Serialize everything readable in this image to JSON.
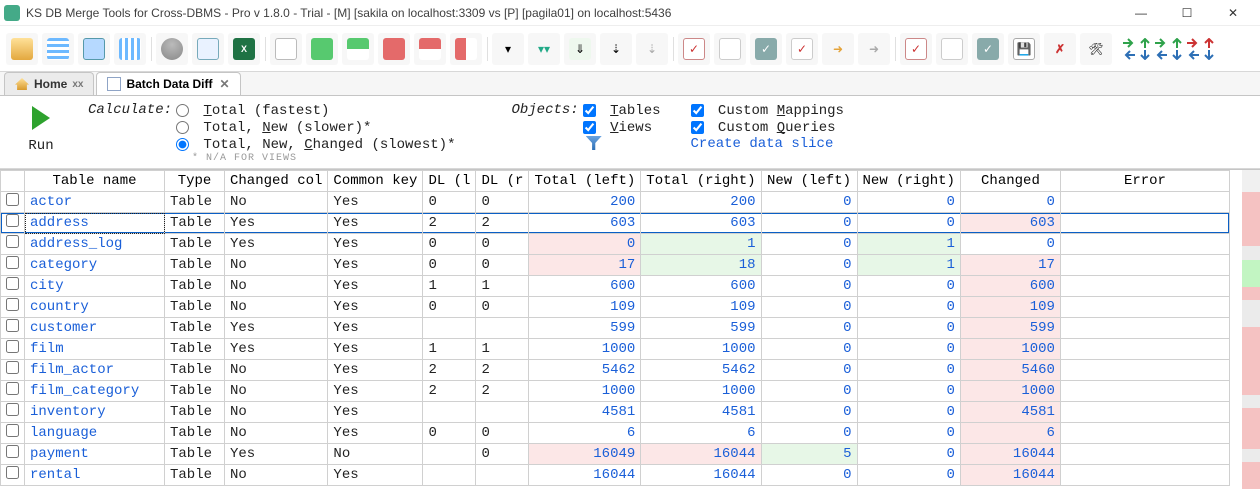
{
  "titlebar": {
    "text": "KS DB Merge Tools for Cross-DBMS - Pro v 1.8.0 - Trial - [M] [sakila on localhost:3309 vs [P] [pagila01] on localhost:5436"
  },
  "tabs": {
    "home": "Home",
    "active": "Batch Data Diff",
    "home_xx": "xx"
  },
  "options": {
    "run": "Run",
    "calculate_label": "Calculate:",
    "calc_total": "Total (fastest)",
    "calc_total_new": "Total, New (slower)*",
    "calc_total_new_chg": "Total, New, Changed (slowest)*",
    "na_note": "* N/A FOR VIEWS",
    "objects_label": "Objects:",
    "tables": "Tables",
    "views": "Views",
    "custom_mappings": "Custom Mappings",
    "custom_queries": "Custom Queries",
    "create_slice": "Create data slice"
  },
  "columns": {
    "name": "Table name",
    "type": "Type",
    "chgcol": "Changed col",
    "ckey": "Common key",
    "dll": "DL (l",
    "dlr": "DL (r",
    "tl": "Total (left)",
    "tr": "Total (right)",
    "nl": "New (left)",
    "nr": "New (right)",
    "chg": "Changed",
    "err": "Error"
  },
  "rows": [
    {
      "name": "actor",
      "type": "Table",
      "chgcol": "No",
      "ckey": "Yes",
      "dll": "0",
      "dlr": "0",
      "tl": "200",
      "tr": "200",
      "nl": "0",
      "nr": "0",
      "chg": "0",
      "err": "",
      "sel": false,
      "hl": {}
    },
    {
      "name": "address",
      "type": "Table",
      "chgcol": "Yes",
      "ckey": "Yes",
      "dll": "2",
      "dlr": "2",
      "tl": "603",
      "tr": "603",
      "nl": "0",
      "nr": "0",
      "chg": "603",
      "err": "",
      "sel": true,
      "hl": {
        "chg": "r"
      }
    },
    {
      "name": "address_log",
      "type": "Table",
      "chgcol": "Yes",
      "ckey": "Yes",
      "dll": "0",
      "dlr": "0",
      "tl": "0",
      "tr": "1",
      "nl": "0",
      "nr": "1",
      "chg": "0",
      "err": "",
      "sel": false,
      "hl": {
        "tl": "r",
        "tr": "g",
        "nr": "g"
      }
    },
    {
      "name": "category",
      "type": "Table",
      "chgcol": "No",
      "ckey": "Yes",
      "dll": "0",
      "dlr": "0",
      "tl": "17",
      "tr": "18",
      "nl": "0",
      "nr": "1",
      "chg": "17",
      "err": "",
      "sel": false,
      "hl": {
        "tl": "r",
        "tr": "g",
        "nr": "g",
        "chg": "r"
      }
    },
    {
      "name": "city",
      "type": "Table",
      "chgcol": "No",
      "ckey": "Yes",
      "dll": "1",
      "dlr": "1",
      "tl": "600",
      "tr": "600",
      "nl": "0",
      "nr": "0",
      "chg": "600",
      "err": "",
      "sel": false,
      "hl": {
        "chg": "r"
      }
    },
    {
      "name": "country",
      "type": "Table",
      "chgcol": "No",
      "ckey": "Yes",
      "dll": "0",
      "dlr": "0",
      "tl": "109",
      "tr": "109",
      "nl": "0",
      "nr": "0",
      "chg": "109",
      "err": "",
      "sel": false,
      "hl": {
        "chg": "r"
      }
    },
    {
      "name": "customer",
      "type": "Table",
      "chgcol": "Yes",
      "ckey": "Yes",
      "dll": "",
      "dlr": "",
      "tl": "599",
      "tr": "599",
      "nl": "0",
      "nr": "0",
      "chg": "599",
      "err": "",
      "sel": false,
      "hl": {
        "chg": "r"
      }
    },
    {
      "name": "film",
      "type": "Table",
      "chgcol": "Yes",
      "ckey": "Yes",
      "dll": "1",
      "dlr": "1",
      "tl": "1000",
      "tr": "1000",
      "nl": "0",
      "nr": "0",
      "chg": "1000",
      "err": "",
      "sel": false,
      "hl": {
        "chg": "r"
      }
    },
    {
      "name": "film_actor",
      "type": "Table",
      "chgcol": "No",
      "ckey": "Yes",
      "dll": "2",
      "dlr": "2",
      "tl": "5462",
      "tr": "5462",
      "nl": "0",
      "nr": "0",
      "chg": "5460",
      "err": "",
      "sel": false,
      "hl": {
        "chg": "r"
      }
    },
    {
      "name": "film_category",
      "type": "Table",
      "chgcol": "No",
      "ckey": "Yes",
      "dll": "2",
      "dlr": "2",
      "tl": "1000",
      "tr": "1000",
      "nl": "0",
      "nr": "0",
      "chg": "1000",
      "err": "",
      "sel": false,
      "hl": {
        "chg": "r"
      }
    },
    {
      "name": "inventory",
      "type": "Table",
      "chgcol": "No",
      "ckey": "Yes",
      "dll": "",
      "dlr": "",
      "tl": "4581",
      "tr": "4581",
      "nl": "0",
      "nr": "0",
      "chg": "4581",
      "err": "",
      "sel": false,
      "hl": {
        "chg": "r"
      }
    },
    {
      "name": "language",
      "type": "Table",
      "chgcol": "No",
      "ckey": "Yes",
      "dll": "0",
      "dlr": "0",
      "tl": "6",
      "tr": "6",
      "nl": "0",
      "nr": "0",
      "chg": "6",
      "err": "",
      "sel": false,
      "hl": {
        "chg": "r"
      }
    },
    {
      "name": "payment",
      "type": "Table",
      "chgcol": "Yes",
      "ckey": "No",
      "dll": "",
      "dlr": "0",
      "tl": "16049",
      "tr": "16044",
      "nl": "5",
      "nr": "0",
      "chg": "16044",
      "err": "",
      "sel": false,
      "hl": {
        "tl": "r",
        "tr": "r",
        "nl": "g",
        "chg": "r"
      }
    },
    {
      "name": "rental",
      "type": "Table",
      "chgcol": "No",
      "ckey": "Yes",
      "dll": "",
      "dlr": "",
      "tl": "16044",
      "tr": "16044",
      "nl": "0",
      "nr": "0",
      "chg": "16044",
      "err": "",
      "sel": false,
      "hl": {
        "chg": "r"
      }
    }
  ],
  "minimap": [
    "r",
    "r",
    "r",
    "r",
    "w",
    "g",
    "g",
    "r",
    "w",
    "w",
    "r",
    "r",
    "r",
    "r",
    "r",
    "w",
    "r",
    "r",
    "r",
    "w",
    "r",
    "r"
  ]
}
